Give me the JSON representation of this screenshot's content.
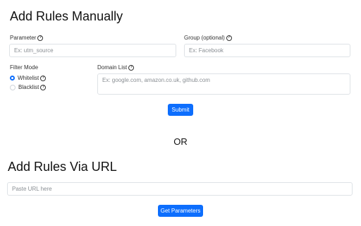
{
  "manual": {
    "title": "Add Rules Manually",
    "parameter_label": "Parameter",
    "parameter_placeholder": "Ex: utm_source",
    "group_label": "Group (optional)",
    "group_placeholder": "Ex: Facebook",
    "filter_mode_label": "Filter Mode",
    "whitelist_label": "Whitelist",
    "blacklist_label": "Blacklist",
    "domain_list_label": "Domain List",
    "domain_list_placeholder": "Ex: google.com, amazon.co.uk, github.com",
    "submit_label": "Submit"
  },
  "or_text": "OR",
  "via_url": {
    "title": "Add Rules Via URL",
    "url_placeholder": "Paste URL here",
    "get_params_label": "Get Parameters"
  },
  "help_icon_glyph": "?",
  "colors": {
    "accent": "#0d6efd"
  }
}
